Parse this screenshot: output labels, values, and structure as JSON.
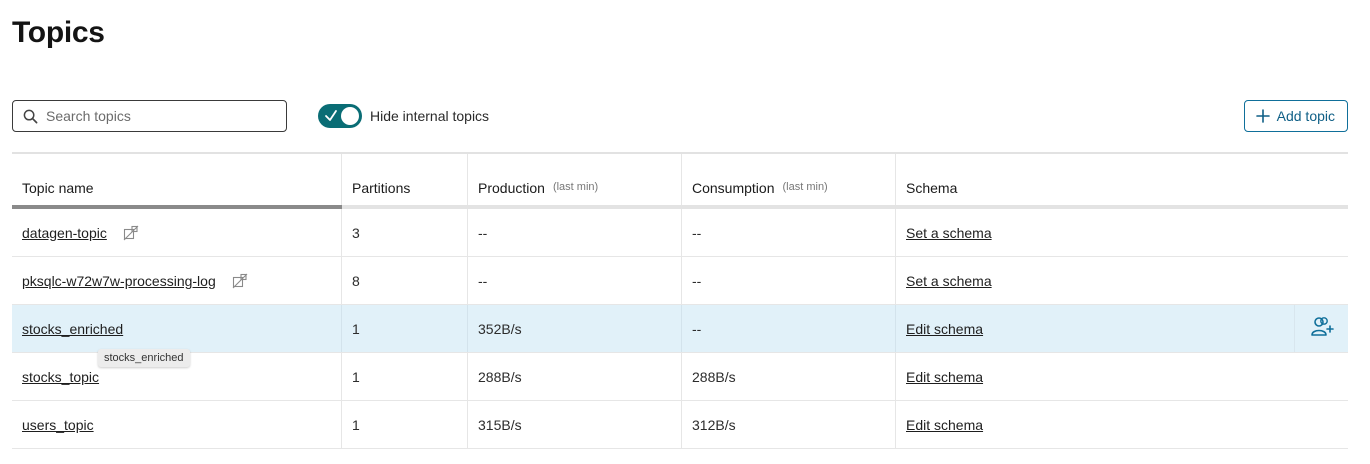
{
  "page": {
    "title": "Topics"
  },
  "toolbar": {
    "search_placeholder": "Search topics",
    "toggle_label": "Hide internal topics",
    "toggle_on": true,
    "add_label": "Add topic"
  },
  "table": {
    "headers": {
      "name": "Topic name",
      "partitions": "Partitions",
      "production": "Production",
      "production_sub": "(last min)",
      "consumption": "Consumption",
      "consumption_sub": "(last min)",
      "schema": "Schema"
    },
    "rows": [
      {
        "name": "datagen-topic",
        "partitions": "3",
        "production": "--",
        "consumption": "--",
        "schema": "Set a schema",
        "icon": "no-schema-icon"
      },
      {
        "name": "pksqlc-w72w7w-processing-log",
        "partitions": "8",
        "production": "--",
        "consumption": "--",
        "schema": "Set a schema",
        "icon": "no-schema-icon"
      },
      {
        "name": "stocks_enriched",
        "partitions": "1",
        "production": "352B/s",
        "consumption": "--",
        "schema": "Edit schema",
        "action_icon": "add-consumer-group-icon"
      },
      {
        "name": "stocks_topic",
        "partitions": "1",
        "production": "288B/s",
        "consumption": "288B/s",
        "schema": "Edit schema"
      },
      {
        "name": "users_topic",
        "partitions": "1",
        "production": "315B/s",
        "consumption": "312B/s",
        "schema": "Edit schema"
      }
    ]
  },
  "tooltip": {
    "text": "stocks_enriched"
  },
  "colors": {
    "accent": "#0a6d75",
    "link_button": "#0f5f86",
    "hover_row": "#e1f1f9"
  }
}
